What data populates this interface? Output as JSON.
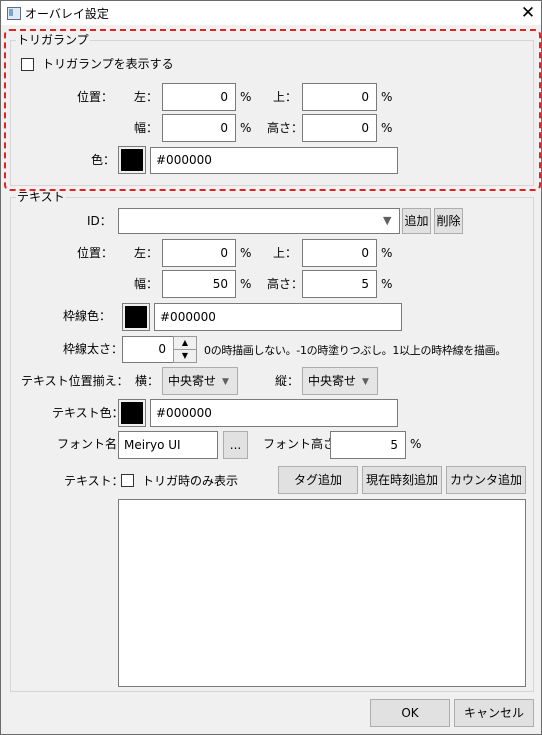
{
  "window": {
    "title": "オーバレイ設定",
    "close": "✕"
  },
  "trigger_lamp": {
    "group_title": "トリガランプ",
    "show_checkbox_label": "トリガランプを表示する",
    "position_label": "位置：",
    "left_label": "左：",
    "top_label": "上：",
    "width_label": "幅：",
    "height_label": "高さ：",
    "left": "0",
    "top": "0",
    "width": "0",
    "height": "0",
    "percent": "%",
    "color_label": "色：",
    "color_hex": "#000000",
    "color": "#000000"
  },
  "text": {
    "group_title": "テキスト",
    "id_label": "ID：",
    "id_value": "",
    "add_button": "追加",
    "delete_button": "削除",
    "position_label": "位置：",
    "left_label": "左：",
    "top_label": "上：",
    "width_label": "幅：",
    "height_label": "高さ：",
    "left": "0",
    "top": "0",
    "width": "50",
    "height": "5",
    "percent": "%",
    "border_color_label": "枠線色：",
    "border_color_hex": "#000000",
    "border_width_label": "枠線太さ：",
    "border_width": "0",
    "border_width_hint": "0の時描画しない。-1の時塗りつぶし。1以上の時枠線を描画。",
    "align_label": "テキスト位置揃え：",
    "horizontal_label": "横：",
    "horizontal_value": "中央寄せ",
    "vertical_label": "縦：",
    "vertical_value": "中央寄せ",
    "text_color_label": "テキスト色：",
    "text_color_hex": "#000000",
    "font_name_label": "フォント名：",
    "font_name": "Meiryo UI",
    "font_browse": "...",
    "font_height_label": "フォント高さ：",
    "font_height": "5",
    "text_label": "テキスト：",
    "trigger_only_label": "トリガ時のみ表示",
    "tag_add_button": "タグ追加",
    "time_add_button": "現在時刻追加",
    "counter_add_button": "カウンタ追加",
    "body": ""
  },
  "footer": {
    "ok": "OK",
    "cancel": "キャンセル"
  },
  "colors": {
    "annotation": "#e02424",
    "swatch": "#000000"
  }
}
